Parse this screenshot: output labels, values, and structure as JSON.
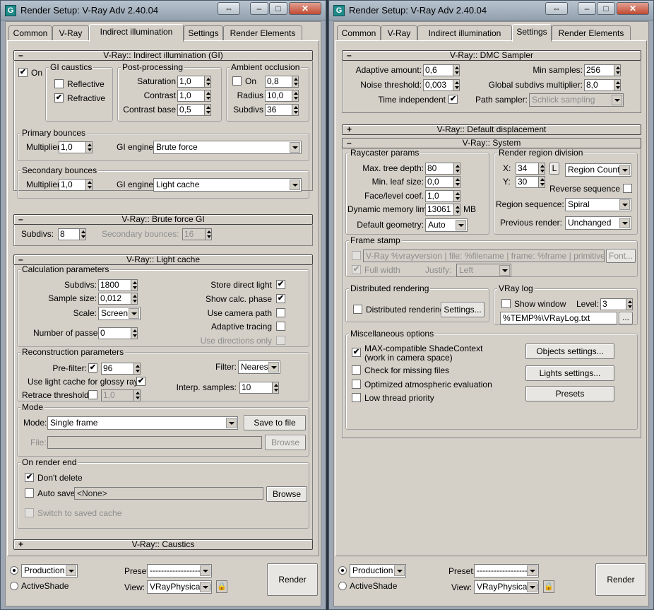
{
  "left": {
    "title": "Render Setup: V-Ray Adv 2.40.04",
    "tabs": [
      "Common",
      "V-Ray",
      "Indirect illumination",
      "Settings",
      "Render Elements"
    ],
    "gi": {
      "header": "V-Ray:: Indirect illumination (GI)",
      "on": "On",
      "caustics": {
        "title": "GI caustics",
        "reflective": "Reflective",
        "refractive": "Refractive"
      },
      "post": {
        "title": "Post-processing",
        "saturation": "Saturation",
        "saturation_v": "1,0",
        "contrast": "Contrast",
        "contrast_v": "1,0",
        "contrast_base": "Contrast base",
        "contrast_base_v": "0,5"
      },
      "ao": {
        "title": "Ambient occlusion",
        "on": "On",
        "on_v": "0,8",
        "radius": "Radius",
        "radius_v": "10,0",
        "subdivs": "Subdivs",
        "subdivs_v": "36"
      },
      "primary": {
        "title": "Primary bounces",
        "multiplier": "Multiplier",
        "multiplier_v": "1,0",
        "engine": "GI engine",
        "engine_v": "Brute force"
      },
      "secondary": {
        "title": "Secondary bounces",
        "multiplier": "Multiplier",
        "multiplier_v": "1,0",
        "engine": "GI engine",
        "engine_v": "Light cache"
      }
    },
    "bf": {
      "header": "V-Ray:: Brute force GI",
      "subdivs": "Subdivs:",
      "subdivs_v": "8",
      "secondary": "Secondary bounces:",
      "secondary_v": "16"
    },
    "lc": {
      "header": "V-Ray:: Light cache",
      "calc": {
        "title": "Calculation parameters",
        "subdivs": "Subdivs:",
        "subdivs_v": "1800",
        "sample_size": "Sample size:",
        "sample_size_v": "0,012",
        "scale": "Scale:",
        "scale_v": "Screen",
        "passes": "Number of passes:",
        "passes_v": "0",
        "store_direct": "Store direct light",
        "show_calc": "Show calc. phase",
        "use_camera": "Use camera path",
        "adaptive": "Adaptive tracing",
        "use_dirs": "Use directions only"
      },
      "recon": {
        "title": "Reconstruction parameters",
        "prefilter": "Pre-filter:",
        "prefilter_v": "96",
        "glossy": "Use light cache for glossy rays",
        "retrace": "Retrace threshold:",
        "retrace_v": "1,0",
        "filter": "Filter:",
        "filter_v": "Nearest",
        "interp": "Interp. samples:",
        "interp_v": "10"
      },
      "mode": {
        "title": "Mode",
        "mode": "Mode:",
        "mode_v": "Single frame",
        "save": "Save to file",
        "file": "File:",
        "browse": "Browse"
      },
      "end": {
        "title": "On render end",
        "dont_delete": "Don't delete",
        "auto_save": "Auto save:",
        "auto_save_v": "<None>",
        "browse": "Browse",
        "switch": "Switch to saved cache"
      }
    },
    "caustics_header": "V-Ray:: Caustics",
    "bottom": {
      "production": "Production",
      "production_v": "Production",
      "activeshade": "ActiveShade",
      "preset": "Preset:",
      "preset_v": "-------------------",
      "view": "View:",
      "view_v": "VRayPhysicalCa",
      "render": "Render"
    }
  },
  "right": {
    "title": "Render Setup: V-Ray Adv 2.40.04",
    "tabs": [
      "Common",
      "V-Ray",
      "Indirect illumination",
      "Settings",
      "Render Elements"
    ],
    "dmc": {
      "header": "V-Ray:: DMC Sampler",
      "adaptive": "Adaptive amount:",
      "adaptive_v": "0,6",
      "noise": "Noise threshold:",
      "noise_v": "0,003",
      "time_indep": "Time independent",
      "min_samples": "Min samples:",
      "min_samples_v": "256",
      "global_subdivs": "Global subdivs multiplier:",
      "global_subdivs_v": "8,0",
      "path_sampler": "Path sampler:",
      "path_sampler_v": "Schlick sampling"
    },
    "disp_header": "V-Ray:: Default displacement",
    "system": {
      "header": "V-Ray:: System",
      "ray": {
        "title": "Raycaster params",
        "max_depth": "Max. tree depth:",
        "max_depth_v": "80",
        "min_leaf": "Min. leaf size:",
        "min_leaf_v": "0,0",
        "face_coef": "Face/level coef.",
        "face_coef_v": "1,0",
        "dyn_mem": "Dynamic memory limit:",
        "dyn_mem_v": "13061",
        "mb": "MB",
        "default_geom": "Default geometry:",
        "default_geom_v": "Auto"
      },
      "region": {
        "title": "Render region division",
        "x": "X:",
        "x_v": "34",
        "y": "Y:",
        "y_v": "30",
        "l": "L",
        "count": "Region Count",
        "reverse": "Reverse sequence",
        "seq": "Region sequence:",
        "seq_v": "Spiral",
        "prev": "Previous render:",
        "prev_v": "Unchanged"
      },
      "stamp": {
        "title": "Frame stamp",
        "text": "V-Ray %vrayversion | file: %filename | frame: %frame | primitives: %primiti",
        "font": "Font...",
        "full_width": "Full width",
        "justify": "Justify:",
        "justify_v": "Left"
      },
      "dist": {
        "title": "Distributed rendering",
        "label": "Distributed rendering",
        "settings": "Settings..."
      },
      "log": {
        "title": "VRay log",
        "show": "Show window",
        "level": "Level:",
        "level_v": "3",
        "path": "%TEMP%\\VRayLog.txt",
        "browse": "..."
      },
      "misc": {
        "title": "Miscellaneous options",
        "max_compat": "MAX-compatible ShadeContext",
        "max_compat2": "(work in camera space)",
        "missing": "Check for missing files",
        "optimized": "Optimized atmospheric evaluation",
        "low_thread": "Low thread priority",
        "objects": "Objects settings...",
        "lights": "Lights settings...",
        "presets": "Presets"
      }
    },
    "bottom": {
      "production": "Production",
      "production_v": "Production",
      "activeshade": "ActiveShade",
      "preset": "Preset:",
      "preset_v": "-------------------",
      "view": "View:",
      "view_v": "VRayPhysicalCa",
      "render": "Render"
    }
  },
  "icons": {
    "app": "3ds-max-icon",
    "check": "✔",
    "restore": "⇔",
    "minimize": "‒",
    "maximize": "□",
    "close": "✕",
    "lock": "lock-icon"
  }
}
